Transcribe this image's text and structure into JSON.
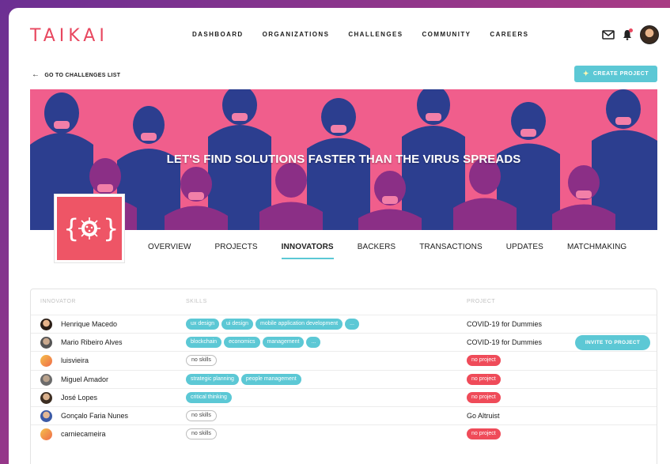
{
  "header": {
    "logo": "TAIKAI",
    "nav": [
      "DASHBOARD",
      "ORGANIZATIONS",
      "CHALLENGES",
      "COMMUNITY",
      "CAREERS"
    ]
  },
  "subheader": {
    "back_label": "GO TO CHALLENGES LIST",
    "create_label": "CREATE PROJECT"
  },
  "banner": {
    "title": "LET'S FIND SOLUTIONS FASTER THAN THE VIRUS SPREADS"
  },
  "challenge_logo": {
    "text": "{ }"
  },
  "tabs": [
    {
      "label": "OVERVIEW",
      "active": false
    },
    {
      "label": "PROJECTS",
      "active": false
    },
    {
      "label": "INNOVATORS",
      "active": true
    },
    {
      "label": "BACKERS",
      "active": false
    },
    {
      "label": "TRANSACTIONS",
      "active": false
    },
    {
      "label": "UPDATES",
      "active": false
    },
    {
      "label": "MATCHMAKING",
      "active": false
    }
  ],
  "table": {
    "headers": {
      "innovator": "INNOVATOR",
      "skills": "SKILLS",
      "project": "PROJECT"
    },
    "rows": [
      {
        "name": "Henrique Macedo",
        "skills": [
          "ux design",
          "ui design",
          "mobile application development",
          "..."
        ],
        "project": "COVID-19 for Dummies",
        "no_project": false,
        "invite": ""
      },
      {
        "name": "Mario Ribeiro Alves",
        "skills": [
          "blockchain",
          "economics",
          "management",
          "..."
        ],
        "project": "COVID-19 for Dummies",
        "no_project": false,
        "invite": "INVITE TO PROJECT"
      },
      {
        "name": "luisvieira",
        "skills": [],
        "no_skills": "no skills",
        "project": "no project",
        "no_project": true,
        "invite": ""
      },
      {
        "name": "Miguel Amador",
        "skills": [
          "strategic planning",
          "people management"
        ],
        "project": "no project",
        "no_project": true,
        "invite": ""
      },
      {
        "name": "José Lopes",
        "skills": [
          "critical thinking"
        ],
        "project": "no project",
        "no_project": true,
        "invite": ""
      },
      {
        "name": "Gonçalo Faria Nunes",
        "skills": [],
        "no_skills": "no skills",
        "project": "Go Altruist",
        "no_project": false,
        "invite": ""
      },
      {
        "name": "carniecameira",
        "skills": [],
        "no_skills": "no skills",
        "project": "no project",
        "no_project": true,
        "invite": ""
      }
    ]
  },
  "colors": {
    "brand": "#e8475f",
    "accent": "#5cc8d5",
    "no_project": "#ef4b59",
    "banner_pink": "#f05e8c",
    "banner_navy": "#2c3e8f"
  },
  "icons": [
    "arrow-left-icon",
    "lightbulb-icon",
    "mail-icon",
    "bell-icon",
    "virus-icon"
  ]
}
